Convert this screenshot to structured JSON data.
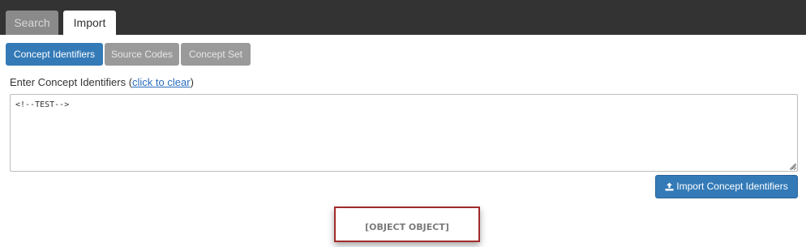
{
  "tabs": {
    "search": "Search",
    "import": "Import"
  },
  "subtabs": {
    "concept_identifiers": "Concept Identifiers",
    "source_codes": "Source Codes",
    "concept_set": "Concept Set"
  },
  "form": {
    "label_prefix": "Enter Concept Identifiers (",
    "clear_link": "click to clear",
    "label_suffix": ")",
    "textarea_value": "<!--TEST-->"
  },
  "buttons": {
    "import_label": "Import Concept Identifiers"
  },
  "error": {
    "message": "[OBJECT OBJECT]"
  },
  "colors": {
    "accent": "#337ab7",
    "error_border": "#a32a2a",
    "topbar": "#333333"
  },
  "icons": {
    "import": "upload-icon"
  }
}
